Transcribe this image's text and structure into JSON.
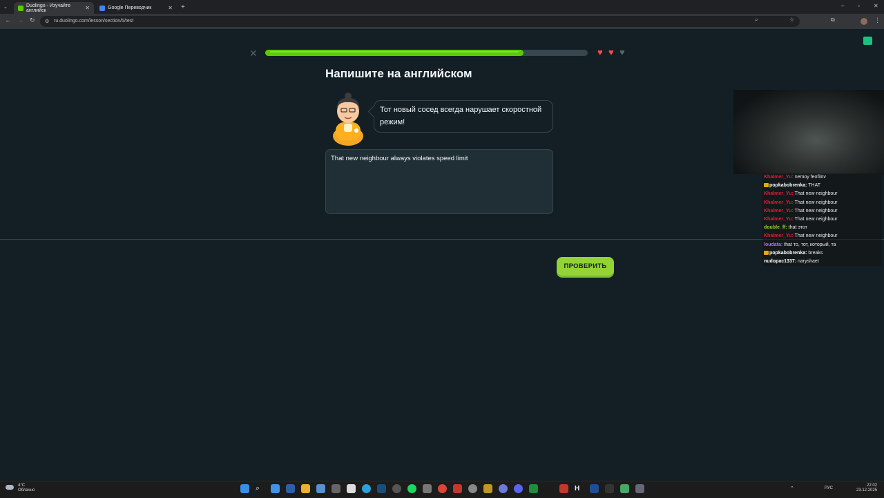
{
  "browser": {
    "tabs": [
      {
        "title": "Duolingo - Изучайте английск",
        "active": true
      },
      {
        "title": "Google Переводчик",
        "active": false
      }
    ],
    "url": "ru.duolingo.com/lesson/section/5/test"
  },
  "lesson": {
    "progress": 0.8,
    "hearts_full": 2,
    "hearts_total": 3,
    "title": "Напишите на английском",
    "prompt": "Тот новый сосед всегда нарушает скоростной режим!",
    "answer": "That new neighbour always violates speed limit",
    "check_label": "ПРОВЕРИТЬ"
  },
  "chat": [
    {
      "user": "Khalmer_Yu:",
      "text": "nemoy feofilov",
      "color": "#e31b3b"
    },
    {
      "user": "popkabobrenka:",
      "text": "THAT",
      "color": "#ffffff",
      "badge": true
    },
    {
      "user": "Khalmer_Yu:",
      "text": "That new neighbour",
      "color": "#e31b3b"
    },
    {
      "user": "Khalmer_Yu:",
      "text": "That new neighbour",
      "color": "#e31b3b"
    },
    {
      "user": "Khalmer_Yu:",
      "text": "That new neighbour",
      "color": "#e31b3b"
    },
    {
      "user": "Khalmer_Yu:",
      "text": "That new neighbour",
      "color": "#e31b3b"
    },
    {
      "user": "double_ff:",
      "text": "that этот",
      "color": "#9acd32"
    },
    {
      "user": "Khalmer_Yu:",
      "text": "That new neighbour",
      "color": "#e31b3b"
    },
    {
      "user": "loudata:",
      "text": "that то, тот, который, та",
      "color": "#b36bff"
    },
    {
      "user": "popkabobrenka:",
      "text": "breaks",
      "color": "#ffffff",
      "badge": true
    },
    {
      "user": "nudopac1337:",
      "text": "naryshaet",
      "color": "#ffffff"
    }
  ],
  "taskbar": {
    "weather_temp": "4°C",
    "weather_text": "Облачно",
    "lang": "РУС",
    "time": "22:02",
    "date": "23.12.2025"
  },
  "colors": {
    "bg": "#131f24",
    "accent_green": "#58cc02",
    "button_green": "#93d333",
    "heart": "#ff4b4b"
  }
}
